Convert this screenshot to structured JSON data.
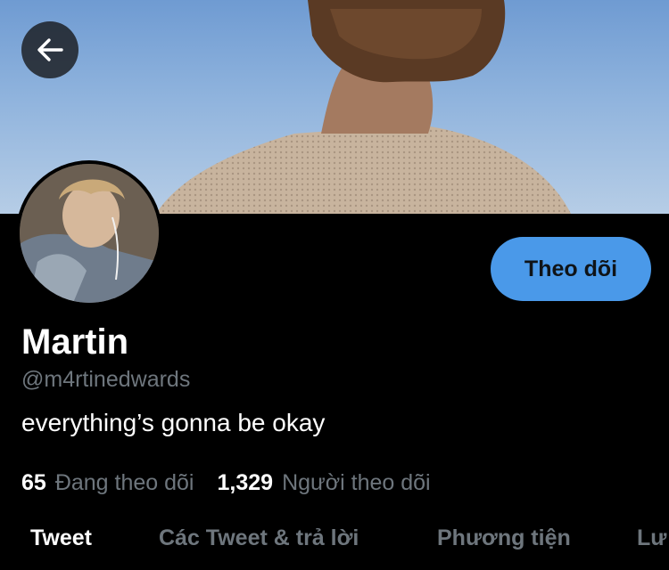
{
  "header": {
    "back_icon": "arrow-left-icon"
  },
  "profile": {
    "name": "Martin",
    "handle": "@m4rtinedwards",
    "bio": "everything’s gonna be okay",
    "follow_label": "Theo dõi",
    "following_count": "65",
    "following_label": "Đang theo dõi",
    "followers_count": "1,329",
    "followers_label": "Người theo dõi"
  },
  "tabs": [
    {
      "label": "Tweet",
      "active": true
    },
    {
      "label": "Các Tweet & trả lời",
      "active": false
    },
    {
      "label": "Phương tiện",
      "active": false
    },
    {
      "label": "Lư",
      "active": false
    }
  ],
  "colors": {
    "accent": "#4a99e9",
    "background": "#000000",
    "secondary_text": "#6e767d"
  }
}
